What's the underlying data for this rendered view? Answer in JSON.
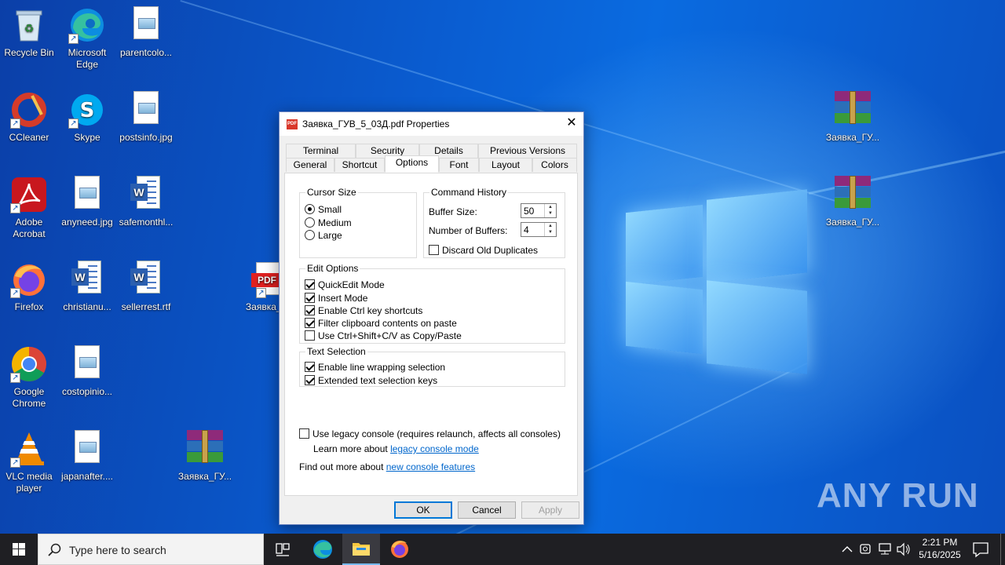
{
  "desktop": {
    "icons": [
      {
        "label": "Recycle Bin"
      },
      {
        "label": "Microsoft Edge"
      },
      {
        "label": "parentcolo..."
      },
      {
        "label": "CCleaner"
      },
      {
        "label": "Skype"
      },
      {
        "label": "postsinfo.jpg"
      },
      {
        "label": "Adobe Acrobat"
      },
      {
        "label": "anyneed.jpg"
      },
      {
        "label": "safemonthl..."
      },
      {
        "label": "Firefox"
      },
      {
        "label": "christianu..."
      },
      {
        "label": "sellerrest.rtf"
      },
      {
        "label": "Заявка_Г"
      },
      {
        "label": "Google Chrome"
      },
      {
        "label": "costopinio..."
      },
      {
        "label": "VLC media player"
      },
      {
        "label": "japanafter...."
      },
      {
        "label": "Заявка_ГУ..."
      },
      {
        "label": "Заявка_ГУ..."
      },
      {
        "label": "Заявка_ГУ..."
      }
    ],
    "pdf_badge": "PDF",
    "watermark": "ANY RUN"
  },
  "dialog": {
    "title": "Заявка_ГУВ_5_03Д.pdf Properties",
    "close_glyph": "✕",
    "tabs_row1": [
      "Terminal",
      "Security",
      "Details",
      "Previous Versions"
    ],
    "tabs_row2": [
      "General",
      "Shortcut",
      "Options",
      "Font",
      "Layout",
      "Colors"
    ],
    "active_tab": "Options",
    "cursor_size": {
      "title": "Cursor Size",
      "options": [
        "Small",
        "Medium",
        "Large"
      ],
      "selected": "Small"
    },
    "command_history": {
      "title": "Command History",
      "buffer_size_label": "Buffer Size:",
      "buffer_size_value": "50",
      "num_buffers_label": "Number of Buffers:",
      "num_buffers_value": "4",
      "discard_label": "Discard Old Duplicates",
      "discard_checked": false
    },
    "edit_options": {
      "title": "Edit Options",
      "items": [
        {
          "label": "QuickEdit Mode",
          "checked": true
        },
        {
          "label": "Insert Mode",
          "checked": true
        },
        {
          "label": "Enable Ctrl key shortcuts",
          "checked": true
        },
        {
          "label": "Filter clipboard contents on paste",
          "checked": true
        },
        {
          "label": "Use Ctrl+Shift+C/V as Copy/Paste",
          "checked": false
        }
      ]
    },
    "text_selection": {
      "title": "Text Selection",
      "items": [
        {
          "label": "Enable line wrapping selection",
          "checked": true
        },
        {
          "label": "Extended text selection keys",
          "checked": true
        }
      ]
    },
    "legacy": {
      "label": "Use legacy console (requires relaunch, affects all consoles)",
      "checked": false,
      "learn_prefix": "Learn more about ",
      "learn_link": "legacy console mode",
      "find_prefix": "Find out more about ",
      "find_link": "new console features"
    },
    "buttons": {
      "ok": "OK",
      "cancel": "Cancel",
      "apply": "Apply"
    }
  },
  "taskbar": {
    "search_placeholder": "Type here to search",
    "time": "2:21 PM",
    "date": "5/16/2025"
  }
}
